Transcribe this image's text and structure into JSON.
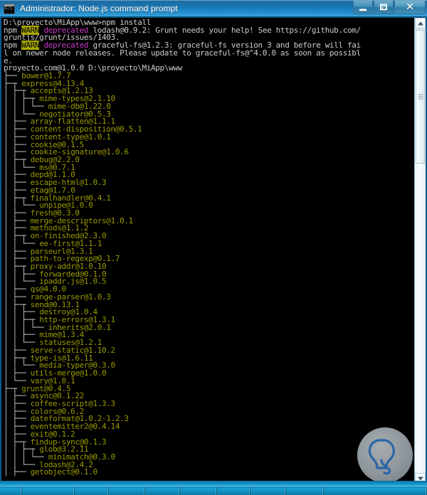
{
  "window": {
    "title": "Administrador: Node.js command prompt",
    "icon_name": "console-icon",
    "icon_glyph": "C:\\",
    "buttons": {
      "minimize": "Minimizar",
      "restore": "Restaurar",
      "close": "Cerrar"
    }
  },
  "scrollbar": {
    "up_arrow": "Desplazar arriba",
    "down_arrow": "Desplazar abajo",
    "thumb": "Barra de desplazamiento vertical"
  },
  "colors": {
    "titlebar": "#1a79b8",
    "console_bg": "#000000",
    "text_white": "#cccccc",
    "text_olive": "#9a9a00",
    "tree_line": "#c8c8c8",
    "warn_bg": "#a8a800",
    "warn_fg": "#000000",
    "deprecated": "#c838c8",
    "taskbar": "#17a0cf"
  },
  "terminal": {
    "prompt_line": "D:\\proyecto\\MiApp\\www>npm install",
    "warnings": [
      {
        "prefix": "npm ",
        "tag": "WARN",
        "label": " deprecated ",
        "message": "lodash@0.9.2: Grunt needs your help! See https://github.com/",
        "continuation": "gruntjs/grunt/issues/1403."
      },
      {
        "prefix": "npm ",
        "tag": "WARN",
        "label": " deprecated ",
        "message": "graceful-fs@1.2.3: graceful-fs version 3 and before will fai",
        "continuation": "l on newer node releases. Please update to graceful-fs@^4.0.0 as soon as possibl",
        "continuation2": "e."
      }
    ],
    "root_line": "proyecto.com@1.0.0 D:\\proyecto\\MiApp\\www",
    "tree": [
      {
        "prefix": "├── ",
        "name": "bower@1.7.7"
      },
      {
        "prefix": "├─┬ ",
        "name": "express@4.13.4"
      },
      {
        "prefix": "│ ├─┬ ",
        "name": "accepts@1.2.13"
      },
      {
        "prefix": "│ │ ├─┬ ",
        "name": "mime-types@2.1.10"
      },
      {
        "prefix": "│ │ │ └── ",
        "name": "mime-db@1.22.0"
      },
      {
        "prefix": "│ │ └── ",
        "name": "negotiator@0.5.3"
      },
      {
        "prefix": "│ ├── ",
        "name": "array-flatten@1.1.1"
      },
      {
        "prefix": "│ ├── ",
        "name": "content-disposition@0.5.1"
      },
      {
        "prefix": "│ ├── ",
        "name": "content-type@1.0.1"
      },
      {
        "prefix": "│ ├── ",
        "name": "cookie@0.1.5"
      },
      {
        "prefix": "│ ├── ",
        "name": "cookie-signature@1.0.6"
      },
      {
        "prefix": "│ ├─┬ ",
        "name": "debug@2.2.0"
      },
      {
        "prefix": "│ │ └── ",
        "name": "ms@0.7.1"
      },
      {
        "prefix": "│ ├── ",
        "name": "depd@1.1.0"
      },
      {
        "prefix": "│ ├── ",
        "name": "escape-html@1.0.3"
      },
      {
        "prefix": "│ ├── ",
        "name": "etag@1.7.0"
      },
      {
        "prefix": "│ ├─┬ ",
        "name": "finalhandler@0.4.1"
      },
      {
        "prefix": "│ │ └── ",
        "name": "unpipe@1.0.0"
      },
      {
        "prefix": "│ ├── ",
        "name": "fresh@0.3.0"
      },
      {
        "prefix": "│ ├── ",
        "name": "merge-descriptors@1.0.1"
      },
      {
        "prefix": "│ ├── ",
        "name": "methods@1.1.2"
      },
      {
        "prefix": "│ ├─┬ ",
        "name": "on-finished@2.3.0"
      },
      {
        "prefix": "│ │ └── ",
        "name": "ee-first@1.1.1"
      },
      {
        "prefix": "│ ├── ",
        "name": "parseurl@1.3.1"
      },
      {
        "prefix": "│ ├── ",
        "name": "path-to-regexp@0.1.7"
      },
      {
        "prefix": "│ ├─┬ ",
        "name": "proxy-addr@1.0.10"
      },
      {
        "prefix": "│ │ ├── ",
        "name": "forwarded@0.1.0"
      },
      {
        "prefix": "│ │ └── ",
        "name": "ipaddr.js@1.0.5"
      },
      {
        "prefix": "│ ├── ",
        "name": "qs@4.0.0"
      },
      {
        "prefix": "│ ├── ",
        "name": "range-parser@1.0.3"
      },
      {
        "prefix": "│ ├─┬ ",
        "name": "send@0.13.1"
      },
      {
        "prefix": "│ │ ├── ",
        "name": "destroy@1.0.4"
      },
      {
        "prefix": "│ │ ├─┬ ",
        "name": "http-errors@1.3.1"
      },
      {
        "prefix": "│ │ │ └── ",
        "name": "inherits@2.0.1"
      },
      {
        "prefix": "│ │ ├── ",
        "name": "mime@1.3.4"
      },
      {
        "prefix": "│ │ └── ",
        "name": "statuses@1.2.1"
      },
      {
        "prefix": "│ ├── ",
        "name": "serve-static@1.10.2"
      },
      {
        "prefix": "│ ├─┬ ",
        "name": "type-is@1.6.11"
      },
      {
        "prefix": "│ │ └── ",
        "name": "media-typer@0.3.0"
      },
      {
        "prefix": "│ ├── ",
        "name": "utils-merge@1.0.0"
      },
      {
        "prefix": "│ └── ",
        "name": "vary@1.0.1"
      },
      {
        "prefix": "├─┬ ",
        "name": "grunt@0.4.5"
      },
      {
        "prefix": "│ ├── ",
        "name": "async@0.1.22"
      },
      {
        "prefix": "│ ├── ",
        "name": "coffee-script@1.3.3"
      },
      {
        "prefix": "│ ├── ",
        "name": "colors@0.6.2"
      },
      {
        "prefix": "│ ├── ",
        "name": "dateformat@1.0.2-1.2.3"
      },
      {
        "prefix": "│ ├── ",
        "name": "eventemitter2@0.4.14"
      },
      {
        "prefix": "│ ├── ",
        "name": "exit@0.1.2"
      },
      {
        "prefix": "│ ├─┬ ",
        "name": "findup-sync@0.1.3"
      },
      {
        "prefix": "│ │ ├─┬ ",
        "name": "glob@3.2.11"
      },
      {
        "prefix": "│ │ │ └── ",
        "name": "minimatch@0.3.0"
      },
      {
        "prefix": "│ │ └── ",
        "name": "lodash@2.4.2"
      },
      {
        "prefix": "│ ├── ",
        "name": "getobject@0.1.0"
      }
    ]
  }
}
